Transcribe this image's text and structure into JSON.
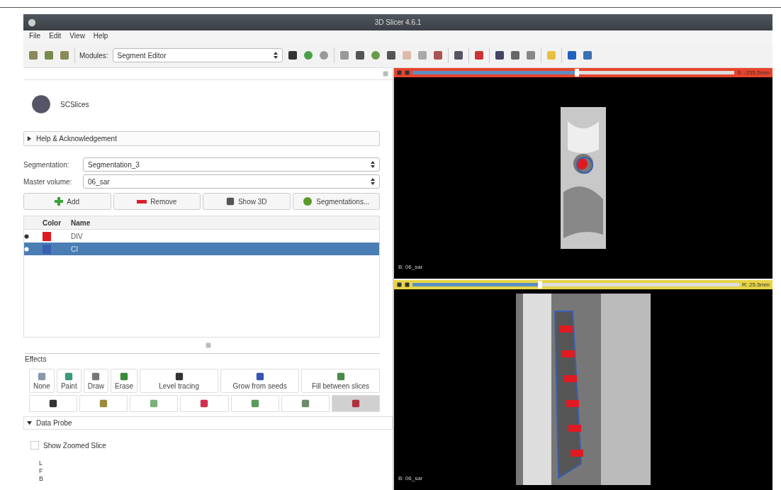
{
  "window": {
    "title": "3D Slicer 4.6.1"
  },
  "menu": [
    "File",
    "Edit",
    "View",
    "Help"
  ],
  "toolbar": {
    "modules_label": "Modules:",
    "module": "Segment Editor"
  },
  "module_panel": {
    "title": "SCSlices",
    "help_section": {
      "label": "Help & Acknowledgement",
      "expanded": false
    },
    "segmentation": {
      "label": "Segmentation:",
      "value": "Segmentation_3"
    },
    "master_volume": {
      "label": "Master volume:",
      "value": "06_sar"
    },
    "buttons": [
      {
        "label": "Add",
        "kind": "add"
      },
      {
        "label": "Remove",
        "kind": "remove"
      },
      {
        "label": "Show 3D",
        "kind": "show3d"
      },
      {
        "label": "Segmentations...",
        "kind": "segmentations"
      }
    ],
    "segments": {
      "columns": [
        "Color",
        "Name"
      ],
      "rows": [
        {
          "name": "DIV",
          "color": "#e01a22",
          "selected": false
        },
        {
          "name": "CI",
          "color": "#3a5fb0",
          "selected": true
        }
      ]
    },
    "effects": {
      "title": "Effects",
      "items": [
        {
          "label": "None",
          "kind": "none",
          "selected": false
        },
        {
          "label": "Paint",
          "kind": "paint",
          "selected": false
        },
        {
          "label": "Draw",
          "kind": "draw",
          "selected": false
        },
        {
          "label": "Erase",
          "kind": "erase",
          "selected": false
        },
        {
          "label": "Level tracing",
          "kind": "level",
          "selected": false
        },
        {
          "label": "Grow from seeds",
          "kind": "grow",
          "selected": false
        },
        {
          "label": "Fill between slices",
          "kind": "fill",
          "selected": false
        }
      ],
      "tools": [
        {
          "kind": "threshold",
          "selected": false
        },
        {
          "kind": "islands",
          "selected": false
        },
        {
          "kind": "margin",
          "selected": false
        },
        {
          "kind": "scissors",
          "selected": false
        },
        {
          "kind": "mask",
          "selected": false
        },
        {
          "kind": "logical",
          "selected": false
        },
        {
          "kind": "smoothing",
          "selected": true
        }
      ]
    },
    "data_probe": {
      "label": "Data Probe",
      "expanded": true,
      "show_zoomed_slice": {
        "label": "Show Zoomed Slice",
        "checked": false
      },
      "rows": [
        "L",
        "F",
        "B"
      ]
    }
  },
  "views": [
    {
      "kind": "axial",
      "color": "#e8432c",
      "level": 0.51,
      "offset": "S: -235.5mm",
      "volume": "B: 06_sar"
    },
    {
      "kind": "sagittal",
      "color": "#e6d447",
      "level": 0.39,
      "offset": "R: 25.5mm",
      "volume": "B: 06_sar"
    }
  ]
}
